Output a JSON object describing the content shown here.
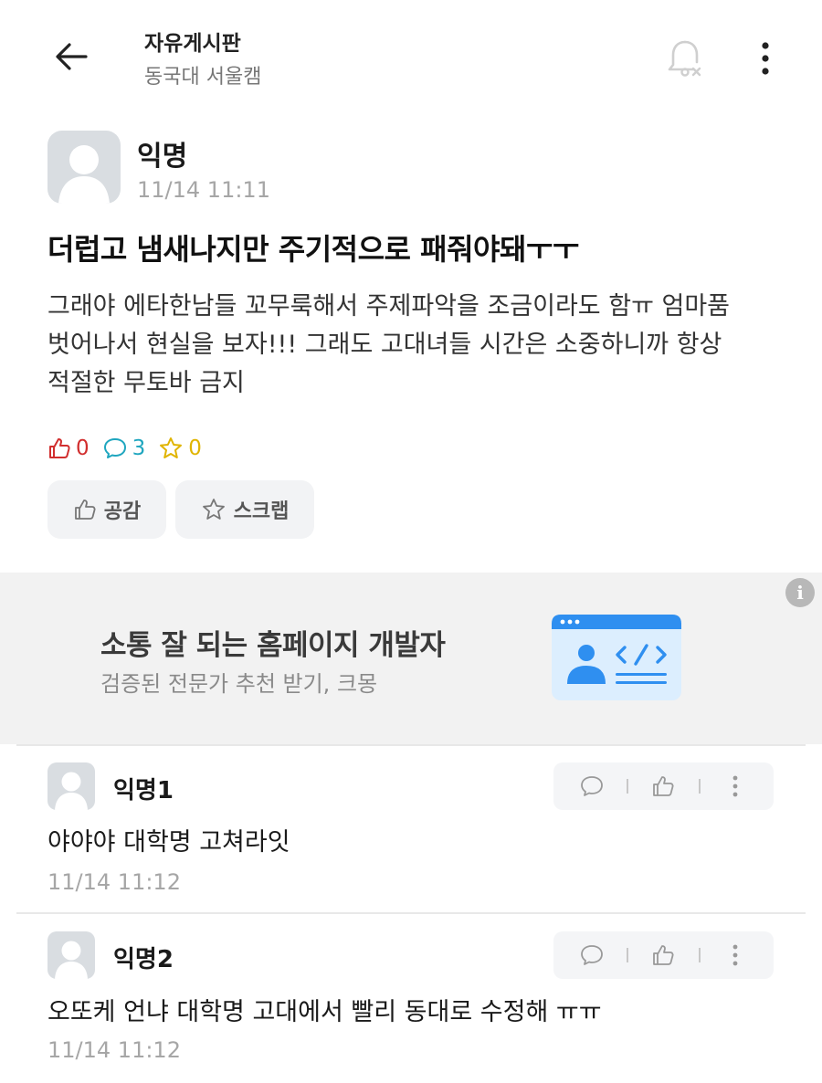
{
  "header": {
    "title": "자유게시판",
    "subtitle": "동국대 서울캠"
  },
  "post": {
    "author": "익명",
    "time": "11/14 11:11",
    "title": "더럽고 냄새나지만 주기적으로 패줘야돼ㅜㅜ",
    "body_lines": [
      "그래야 에타한남들 꼬무룩해서 주제파악을 조금이라도 함ㅠ 엄마품",
      "벗어나서 현실을 보자!!! 그래도 고대녀들 시간은 소중하니까 항상",
      "적절한 무토바 금지"
    ],
    "counts": {
      "likes": "0",
      "comments": "3",
      "scraps": "0"
    },
    "buttons": {
      "like_label": "공감",
      "scrap_label": "스크랩"
    }
  },
  "ad": {
    "title": "소통 잘 되는 홈페이지 개발자",
    "subtitle": "검증된 전문가 추천 받기, 크몽",
    "info": "i"
  },
  "comments": [
    {
      "author": "익명1",
      "text": "야야야 대학명 고쳐라잇",
      "time": "11/14 11:12"
    },
    {
      "author": "익명2",
      "text": "오또케 언냐 대학명 고대에서 빨리 동대로 수정해 ㅠㅠ",
      "time": "11/14 11:12"
    }
  ],
  "colors": {
    "like": "#d12e2e",
    "comment": "#1fa6bf",
    "scrap": "#e0b400",
    "ad_accent": "#2f8ff0"
  },
  "icons": [
    "back-arrow-icon",
    "bell-off-icon",
    "more-vertical-icon",
    "thumbs-up-icon",
    "comment-icon",
    "star-icon",
    "info-icon",
    "developer-illustration"
  ]
}
